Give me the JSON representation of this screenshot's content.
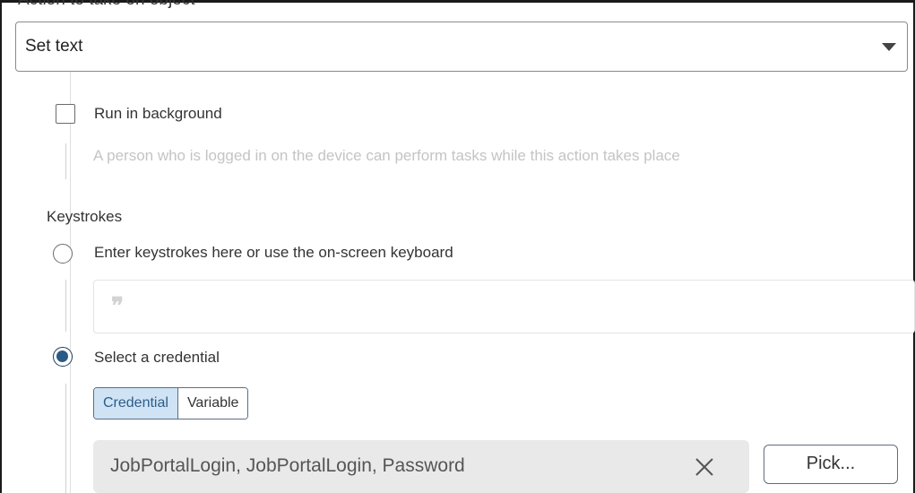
{
  "action": {
    "label_cut": "Action to take on object",
    "selected": "Set text"
  },
  "background": {
    "checkbox_label": "Run in background",
    "checked": false,
    "help_text": "A person who is logged in on the device can perform tasks while this action takes place"
  },
  "keystrokes": {
    "section_title": "Keystrokes",
    "option_enter_label": "Enter keystrokes here or use the on-screen keyboard",
    "option_enter_selected": false,
    "input_icon": "quote-icon",
    "option_credential_label": "Select a credential",
    "option_credential_selected": true
  },
  "credential": {
    "segment": {
      "options": [
        "Credential",
        "Variable"
      ],
      "active": "Credential"
    },
    "value": "JobPortalLogin, JobPortalLogin, Password",
    "clear_icon": "close-icon",
    "pick_label": "Pick..."
  },
  "colors": {
    "accent": "#2b5a86",
    "segment_active_bg": "#cfe3f4",
    "field_bg": "#e9e9e9"
  }
}
